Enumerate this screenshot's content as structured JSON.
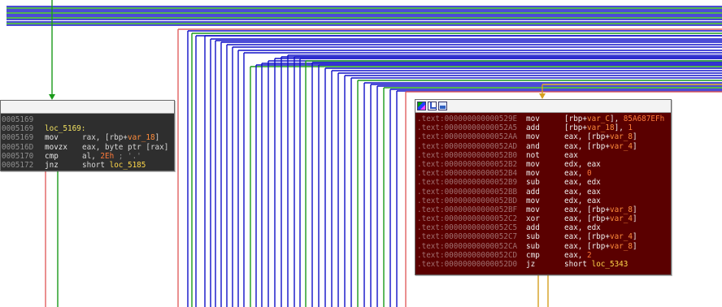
{
  "edge_colors": {
    "blue": "#1010c8",
    "green": "#1a9a1a",
    "red": "#e06060",
    "orange": "#d6a020"
  },
  "left_block": {
    "background": "#2e2e2e",
    "header_icons": [],
    "lines": [
      {
        "addr": "0005169",
        "mnem": "",
        "ops": ""
      },
      {
        "addr": "0005169",
        "label": "loc_5169:"
      },
      {
        "addr": "0005169",
        "mnem": "mov",
        "ops": "rax, [rbp+var_18]"
      },
      {
        "addr": "000516D",
        "mnem": "movzx",
        "ops": "eax, byte ptr [rax]"
      },
      {
        "addr": "0005170",
        "mnem": "cmp",
        "ops": "al, 2Eh ; '.'"
      },
      {
        "addr": "0005172",
        "mnem": "jnz",
        "ops": "short loc_5185"
      }
    ]
  },
  "right_block": {
    "background": "#5a0000",
    "header_icons": [
      "color-icon",
      "graph-icon",
      "image-icon"
    ],
    "lines": [
      {
        "addr": ".text:000000000000529E",
        "mnem": "mov",
        "ops": "[rbp+var_C], 85A687EFh"
      },
      {
        "addr": ".text:00000000000052A5",
        "mnem": "add",
        "ops": "[rbp+var_18], 1"
      },
      {
        "addr": ".text:00000000000052AA",
        "mnem": "mov",
        "ops": "eax, [rbp+var_8]"
      },
      {
        "addr": ".text:00000000000052AD",
        "mnem": "and",
        "ops": "eax, [rbp+var_4]"
      },
      {
        "addr": ".text:00000000000052B0",
        "mnem": "not",
        "ops": "eax"
      },
      {
        "addr": ".text:00000000000052B2",
        "mnem": "mov",
        "ops": "edx, eax"
      },
      {
        "addr": ".text:00000000000052B4",
        "mnem": "mov",
        "ops": "eax, 0"
      },
      {
        "addr": ".text:00000000000052B9",
        "mnem": "sub",
        "ops": "eax, edx"
      },
      {
        "addr": ".text:00000000000052BB",
        "mnem": "add",
        "ops": "eax, eax"
      },
      {
        "addr": ".text:00000000000052BD",
        "mnem": "mov",
        "ops": "edx, eax"
      },
      {
        "addr": ".text:00000000000052BF",
        "mnem": "mov",
        "ops": "eax, [rbp+var_8]"
      },
      {
        "addr": ".text:00000000000052C2",
        "mnem": "xor",
        "ops": "eax, [rbp+var_4]"
      },
      {
        "addr": ".text:00000000000052C5",
        "mnem": "add",
        "ops": "eax, edx"
      },
      {
        "addr": ".text:00000000000052C7",
        "mnem": "sub",
        "ops": "eax, [rbp+var_4]"
      },
      {
        "addr": ".text:00000000000052CA",
        "mnem": "sub",
        "ops": "eax, [rbp+var_8]"
      },
      {
        "addr": ".text:00000000000052CD",
        "mnem": "cmp",
        "ops": "eax, 2"
      },
      {
        "addr": ".text:00000000000052D0",
        "mnem": "jz",
        "ops": "short loc_5343"
      }
    ]
  }
}
